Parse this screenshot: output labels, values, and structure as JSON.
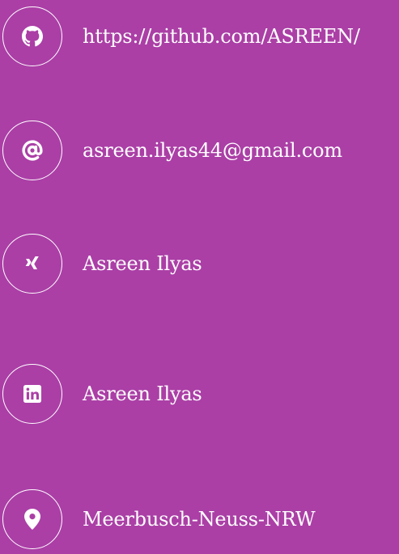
{
  "contacts": [
    {
      "id": "github",
      "icon": "github-icon",
      "label": "https://github.com/ASREEN/"
    },
    {
      "id": "email",
      "icon": "at-sign-icon",
      "label": "asreen.ilyas44@gmail.com"
    },
    {
      "id": "xing",
      "icon": "xing-icon",
      "label": "Asreen Ilyas"
    },
    {
      "id": "linkedin",
      "icon": "linkedin-icon",
      "label": "Asreen Ilyas"
    },
    {
      "id": "location",
      "icon": "map-pin-icon",
      "label": "Meerbusch-Neuss-NRW"
    }
  ],
  "colors": {
    "background": "#ab3fa6",
    "foreground": "#ffffff"
  }
}
